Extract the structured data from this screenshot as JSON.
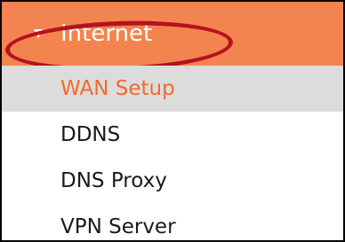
{
  "colors": {
    "header_bg": "#f4844f",
    "active_item_bg": "#dcdcdc",
    "active_item_text": "#f26a2d",
    "item_text": "#1a1a1a",
    "highlight_ring": "#b3131f"
  },
  "menu": {
    "label": "Internet",
    "icon": "expanded-triangle-icon",
    "expanded": true,
    "items": [
      {
        "label": "WAN Setup",
        "active": true
      },
      {
        "label": "DDNS",
        "active": false
      },
      {
        "label": "DNS Proxy",
        "active": false
      },
      {
        "label": "VPN Server",
        "active": false
      }
    ]
  }
}
